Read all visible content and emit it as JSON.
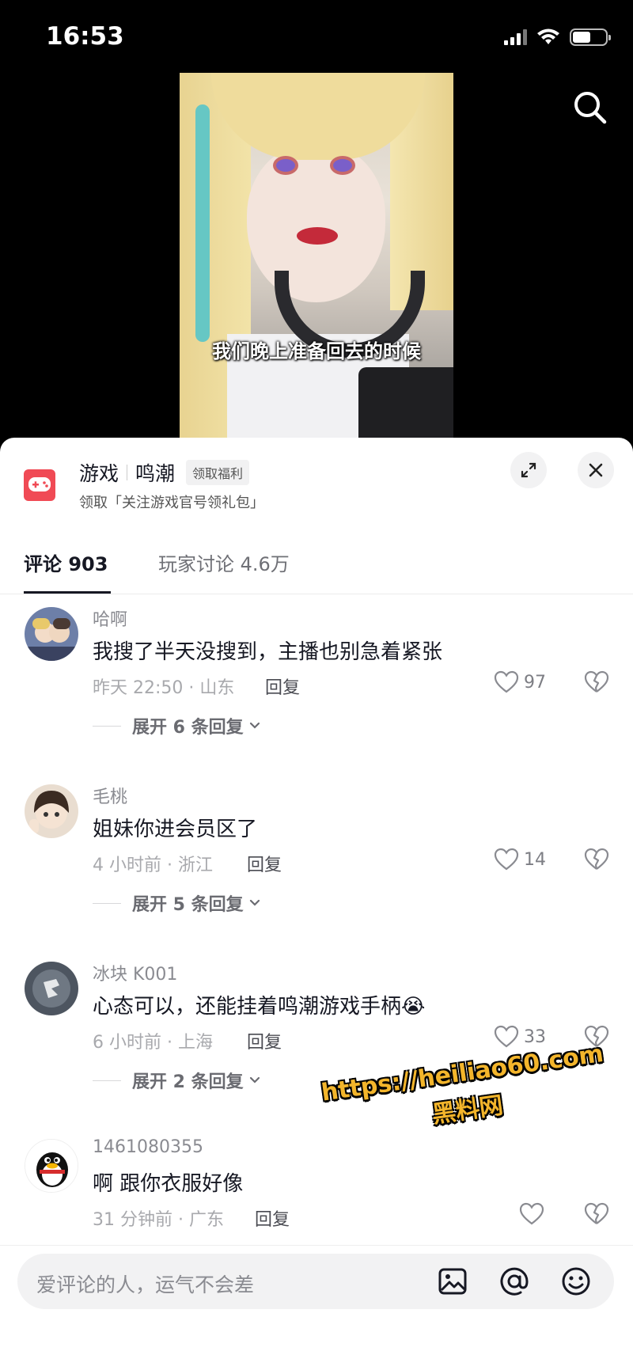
{
  "status_bar": {
    "time": "16:53"
  },
  "video": {
    "subtitle": "我们晚上准备回去的时候"
  },
  "game": {
    "category": "游戏",
    "name": "鸣潮",
    "tag": "领取福利",
    "subtitle": "领取「关注游戏官号领礼包」"
  },
  "tabs": [
    {
      "label": "评论 903"
    },
    {
      "label": "玩家讨论 4.6万"
    }
  ],
  "comments": [
    {
      "user": "哈啊",
      "text": "我搜了半天没搜到，主播也别急着紧张",
      "meta": "昨天 22:50 · 山东",
      "reply": "回复",
      "likes": "97",
      "expand": "展开 6 条回复"
    },
    {
      "user": "毛桃",
      "text": "姐妹你进会员区了",
      "meta": "4 小时前 · 浙江",
      "reply": "回复",
      "likes": "14",
      "expand": "展开 5 条回复"
    },
    {
      "user": "冰块 K001",
      "text": "心态可以，还能挂着鸣潮游戏手柄😭",
      "meta": "6 小时前 · 上海",
      "reply": "回复",
      "likes": "33",
      "expand": "展开 2 条回复"
    },
    {
      "user": "1461080355",
      "text": "啊 跟你衣服好像",
      "meta": "31 分钟前 · 广东",
      "reply": "回复",
      "likes": "",
      "expand": ""
    }
  ],
  "watermark": {
    "url": "https://heiliao60.com",
    "name": "黑料网"
  },
  "input": {
    "placeholder": "爱评论的人，运气不会差"
  },
  "colors": {
    "accent": "#f04a55",
    "watermark": "#f3b52b"
  }
}
